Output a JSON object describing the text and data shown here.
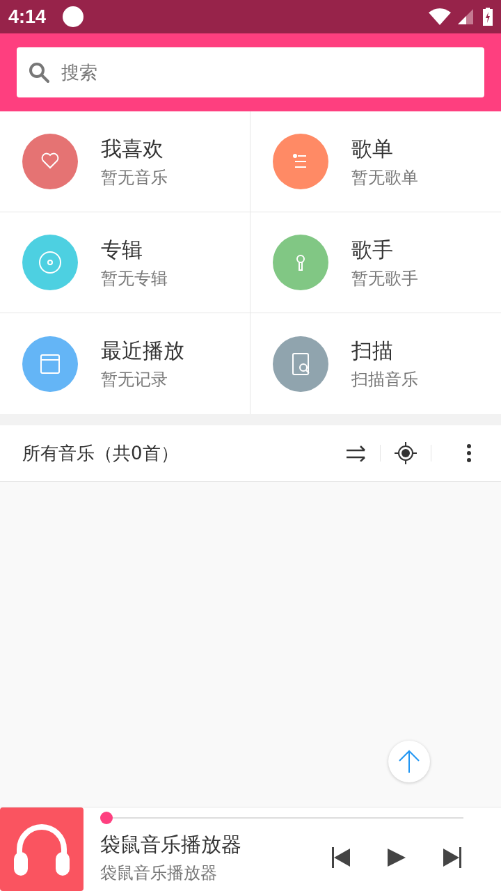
{
  "status_bar": {
    "time": "4:14"
  },
  "search": {
    "placeholder": "搜索"
  },
  "categories": [
    {
      "title": "我喜欢",
      "subtitle": "暂无音乐",
      "color": "#e57373"
    },
    {
      "title": "歌单",
      "subtitle": "暂无歌单",
      "color": "#ff8a65"
    },
    {
      "title": "专辑",
      "subtitle": "暂无专辑",
      "color": "#4dd0e1"
    },
    {
      "title": "歌手",
      "subtitle": "暂无歌手",
      "color": "#81c784"
    },
    {
      "title": "最近播放",
      "subtitle": "暂无记录",
      "color": "#64b5f6"
    },
    {
      "title": "扫描",
      "subtitle": "扫描音乐",
      "color": "#90a4ae"
    }
  ],
  "list_header": {
    "title": "所有音乐（共0首）"
  },
  "player": {
    "title": "袋鼠音乐播放器",
    "subtitle": "袋鼠音乐播放器",
    "level": 0
  }
}
